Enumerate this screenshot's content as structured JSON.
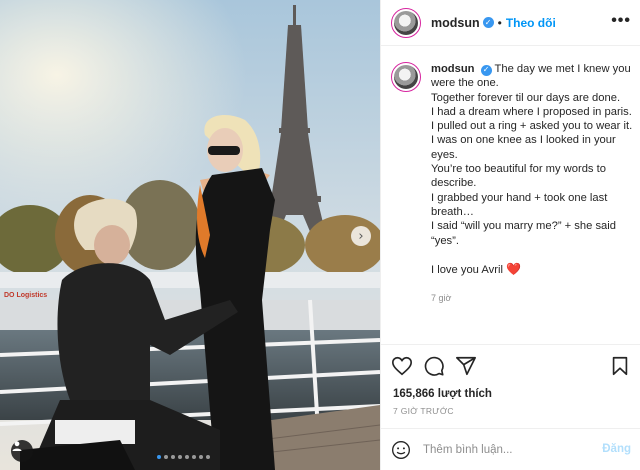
{
  "post": {
    "username": "modsun",
    "verified_icon": "verified-badge-icon",
    "separator": "•",
    "follow_label": "Theo dõi",
    "more_icon": "more-options-icon",
    "more_label": "•••",
    "caption_lines": [
      "The day we met I knew you were the one.",
      "Together forever til our days are done.",
      "I had a dream where I proposed in paris.",
      "I pulled out a ring + asked you to wear it.",
      "I was on one knee as I looked in your eyes.",
      "You’re too beautiful for my words to describe.",
      "I grabbed your hand + took one last breath…",
      "I said “will you marry me?” + she said “yes”.",
      "",
      "I love you Avril"
    ],
    "caption_emoji": "❤️",
    "caption_time": "7 giờ",
    "likes": "165,866 lượt thích",
    "posted_time": "7 GIỜ TRƯỚC",
    "comment_placeholder": "Thêm bình luận...",
    "post_label": "Đăng",
    "next_label": "›"
  },
  "carousel": {
    "slide_count": 8,
    "active_index": 0
  },
  "colors": {
    "accent": "#0095f6",
    "verified": "#3897f0",
    "heart": "#ed1c24",
    "muted": "#8e8e8e"
  },
  "icons": [
    "heart-icon",
    "comment-icon",
    "share-icon",
    "bookmark-icon",
    "emoji-icon",
    "person-tag-icon",
    "chevron-right-icon"
  ]
}
